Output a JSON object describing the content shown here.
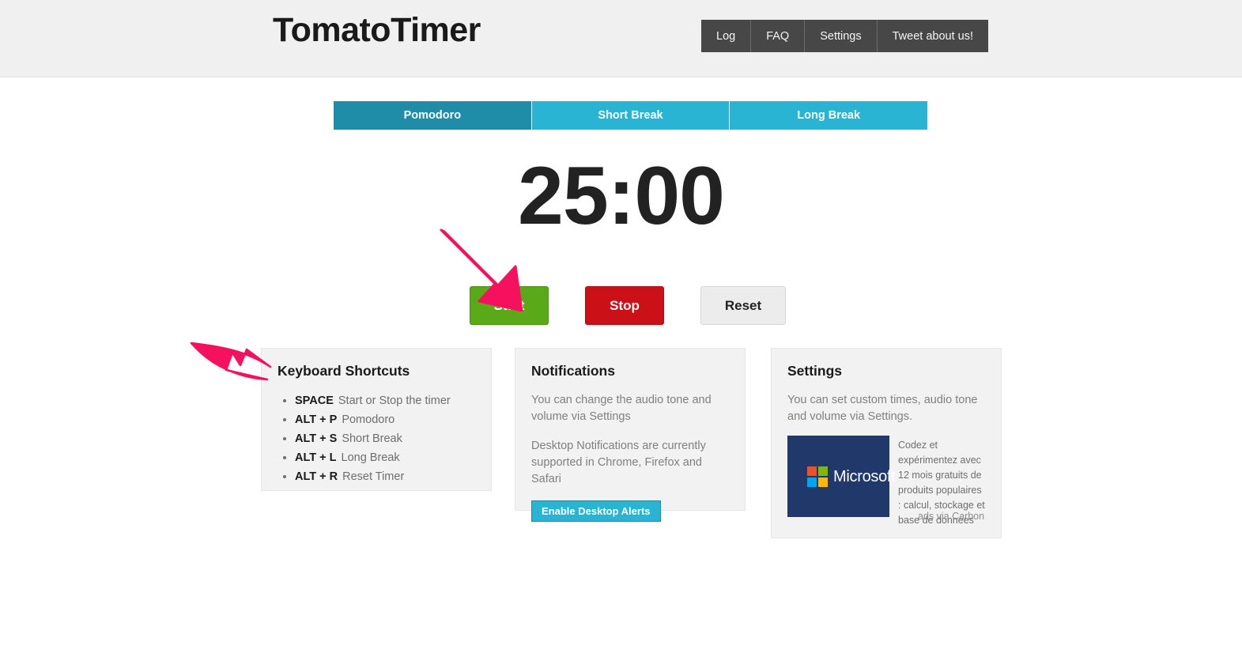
{
  "header": {
    "brand": "TomatoTimer",
    "nav": [
      {
        "label": "Log",
        "name": "nav-log"
      },
      {
        "label": "FAQ",
        "name": "nav-faq"
      },
      {
        "label": "Settings",
        "name": "nav-settings"
      },
      {
        "label": "Tweet about us!",
        "name": "nav-tweet"
      }
    ]
  },
  "tabs": [
    {
      "label": "Pomodoro",
      "active": true
    },
    {
      "label": "Short Break",
      "active": false
    },
    {
      "label": "Long Break",
      "active": false
    }
  ],
  "timer": {
    "display": "25:00"
  },
  "controls": {
    "start": "Start",
    "stop": "Stop",
    "reset": "Reset"
  },
  "panels": {
    "shortcuts": {
      "title": "Keyboard Shortcuts",
      "items": [
        {
          "key": "SPACE",
          "action": "Start or Stop the timer"
        },
        {
          "key": "ALT + P",
          "action": "Pomodoro"
        },
        {
          "key": "ALT + S",
          "action": "Short Break"
        },
        {
          "key": "ALT + L",
          "action": "Long Break"
        },
        {
          "key": "ALT + R",
          "action": "Reset Timer"
        }
      ]
    },
    "notifications": {
      "title": "Notifications",
      "paragraph1": "You can change the audio tone and volume via Settings",
      "paragraph2": "Desktop Notifications are currently supported in Chrome, Firefox and Safari",
      "button": "Enable Desktop Alerts"
    },
    "settings": {
      "title": "Settings",
      "paragraph1": "You can set custom times, audio tone and volume via Settings.",
      "ad": {
        "logo_text": "Microsoft",
        "body": "Codez et expérimentez avec 12 mois gratuits de produits populaires : calcul, stockage et base de données",
        "attribution": "ads via Carbon"
      }
    }
  },
  "colors": {
    "header_bg": "#f0f0f0",
    "nav_bg": "#474747",
    "tab_active": "#1f8ca8",
    "tab_inactive": "#29b4d3",
    "start_green": "#5aa919",
    "stop_red": "#cc1017",
    "reset_gray": "#ececec",
    "panel_bg": "#f2f2f2",
    "alert_blue": "#29b4d3",
    "ad_navy": "#20386a",
    "annotation_pink": "#f5115e",
    "ms_red": "#f25022",
    "ms_green": "#7fba00",
    "ms_blue": "#00a4ef",
    "ms_yellow": "#ffb900"
  },
  "annotations": [
    {
      "name": "arrow-to-start-button",
      "color": "#f5115e",
      "points_to": "Start"
    },
    {
      "name": "arrow-to-keyboard-shortcuts",
      "color": "#f5115e",
      "points_to": "Keyboard Shortcuts"
    }
  ]
}
